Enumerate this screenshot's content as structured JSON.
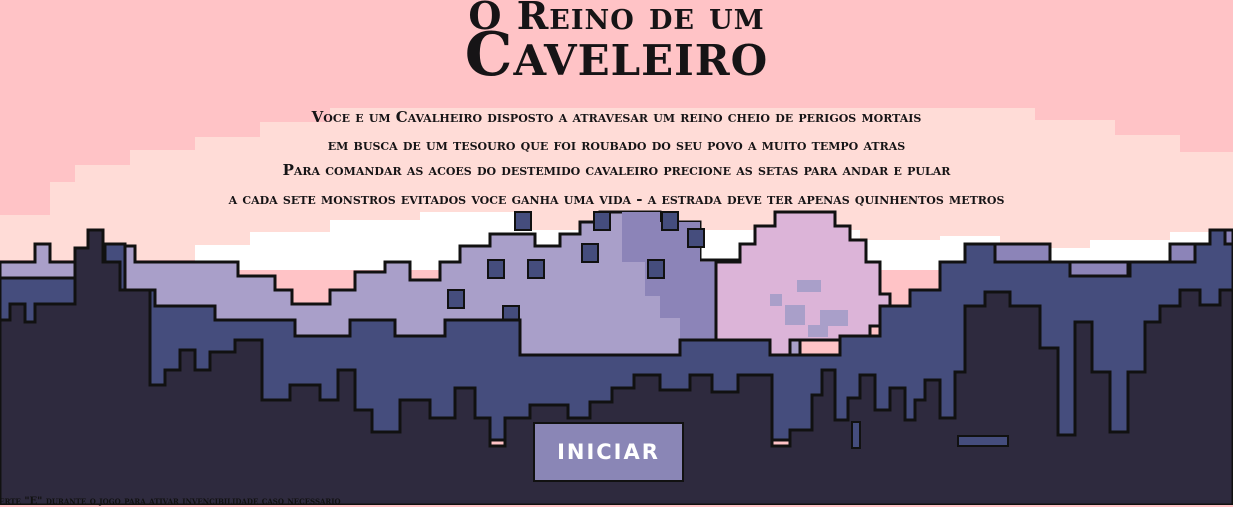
{
  "title": {
    "line1": "O Reino de um",
    "line2": "Caveleiro"
  },
  "intro": [
    "Voce e um Cavalheiro disposto a atravesar um reino cheio de perigos mortais",
    "em busca de um tesouro que foi roubado do seu povo a muito tempo atras",
    "Para comandar as acoes do destemido cavaleiro precione as setas para andar e pular",
    "a cada sete monstros evitados voce ganha uma vida - a estrada deve ter apenas quinhentos metros"
  ],
  "start_button": {
    "label": "INICIAR"
  },
  "hint": "perte \"E\" durante o jogo para ativar invencibilidade caso necessario",
  "colors": {
    "sky": "#ffc3c6",
    "cloud_mid": "#ffdcd7",
    "cloud_light": "#ffffff",
    "far_hills": "#a99fc9",
    "far_hills_shade": "#8c84b8",
    "tree_pink": "#dcb4d8",
    "mid_city": "#454d7d",
    "near_city": "#2e2a3e",
    "outline": "#111111",
    "button": "#8a86b6"
  }
}
